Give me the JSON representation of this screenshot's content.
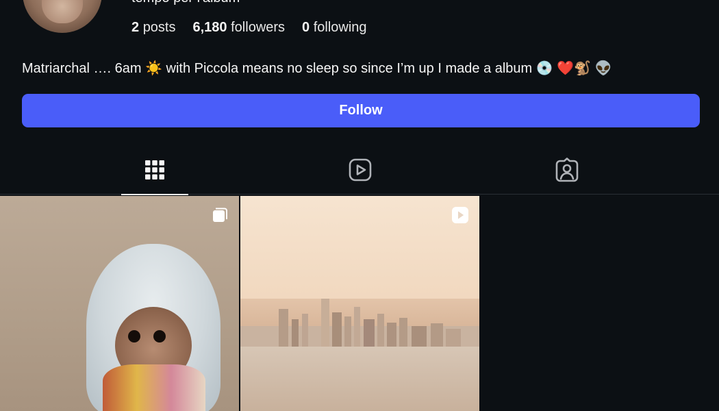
{
  "profile": {
    "username_partial": "tempo per l'album",
    "stats": [
      {
        "value": "2",
        "label": "posts"
      },
      {
        "value": "6,180",
        "label": "followers"
      },
      {
        "value": "0",
        "label": "following"
      }
    ],
    "bio": "Matriarchal …. 6am ☀️ with Piccola means no sleep so since I’m up I made a album 💿 ❤️🐒 👽"
  },
  "actions": {
    "follow_label": "Follow",
    "accent_color": "#4a5df9"
  },
  "tabs": [
    {
      "name": "posts",
      "icon": "grid-icon",
      "active": true
    },
    {
      "name": "reels",
      "icon": "reels-icon",
      "active": false
    },
    {
      "name": "tagged",
      "icon": "tagged-icon",
      "active": false
    }
  ],
  "posts": [
    {
      "type": "carousel",
      "badge_icon": "multiple-posts-icon",
      "subject": "baby monkey in a fleece hood"
    },
    {
      "type": "reel",
      "badge_icon": "reel-icon",
      "subject": "hazy city skyline over water"
    }
  ]
}
